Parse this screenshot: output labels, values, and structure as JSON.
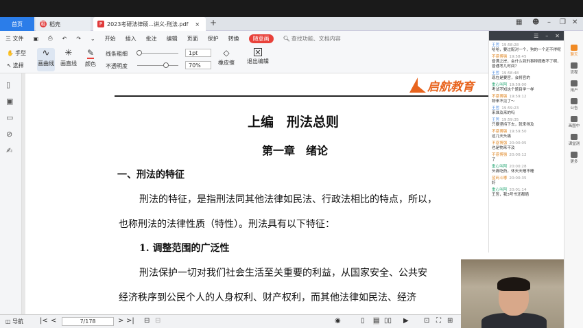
{
  "tabs": {
    "home": "首页",
    "docer": "稻壳",
    "pdf": "2023考研法律硕...讲义-刑法.pdf",
    "add": "+"
  },
  "menu": {
    "file": "三 文件",
    "items": [
      "开始",
      "插入",
      "批注",
      "编辑",
      "页面",
      "保护",
      "转换"
    ],
    "highlight": "随意画",
    "search_placeholder": "查找功能、文档内容"
  },
  "toolbar": {
    "hand": "手型",
    "select": "选择",
    "draw_curve": "画曲线",
    "draw_line": "画直线",
    "color": "颜色",
    "line_weight": "线条粗细",
    "opacity": "不透明度",
    "weight_value": "1pt",
    "opacity_value": "70%",
    "eraser": "橡皮擦",
    "exit": "退出编辑",
    "weight_level": 0.05,
    "opacity_level": 0.7
  },
  "document": {
    "logo": "启航教育",
    "part_title": "上编　刑法总则",
    "chapter_title": "第一章　绪论",
    "section1": "一、刑法的特征",
    "para1_line1": "刑法的特征，是指刑法同其他法律如民法、行政法相比的特点，所以，",
    "para1_line2": "也称刑法的法律性质（特性）。刑法具有以下特征：",
    "sub1": "1. 调整范围的广泛性",
    "para2_line1": "刑法保护一切对我们社会生活至关重要的利益，从国家安全、公共安",
    "para2_line2": "经济秩序到公民个人的人身权利、财产权利，而其他法律如民法、经济"
  },
  "status": {
    "nav": "导航",
    "page": "7/178"
  },
  "chat": {
    "messages": [
      {
        "name": "王哲",
        "time": "19:58:28",
        "text": "哈哈，要过配对一个，狗的一个还不得呢",
        "c": "b"
      },
      {
        "name": "不惑博强",
        "time": "19:58:45",
        "text": "昏满之岸，会什么到刑事辩题看不了啊，普通考几时间？",
        "c": "o"
      },
      {
        "name": "王哲",
        "time": "19:58:48",
        "text": "现在是要官，会将官的",
        "c": "b"
      },
      {
        "name": "重心叫阿",
        "time": "19:59:00",
        "text": "考试不知这个题目学一样",
        "c": "g"
      },
      {
        "name": "不惑博强",
        "time": "19:59:12",
        "text": "物来不见了～",
        "c": "o"
      },
      {
        "name": "王哲",
        "time": "19:59:23",
        "text": "来准及来的吗",
        "c": "b"
      },
      {
        "name": "王哲",
        "time": "19:59:35",
        "text": "只要坚持下去，就来得及",
        "c": "b"
      },
      {
        "name": "不惑博强",
        "time": "19:59:50",
        "text": "这几天头痛",
        "c": "o"
      },
      {
        "name": "不惑博强",
        "time": "20:00:05",
        "text": "也是物来不及",
        "c": "o"
      },
      {
        "name": "不惑博强",
        "time": "20:00:12",
        "text": "了",
        "c": "o"
      },
      {
        "name": "重心叫阿",
        "time": "20:00:28",
        "text": "头痛吃药，休天天睡不睡",
        "c": "g"
      },
      {
        "name": "蓝码斗嘟",
        "time": "20:00:35",
        "text": "好",
        "c": "o"
      },
      {
        "name": "重心叫阿",
        "time": "20:01:14",
        "text": "王哲，我3号书还都晒",
        "c": "g"
      }
    ]
  },
  "right_sidebar": [
    "聊天",
    "流程",
    "用户",
    "公告",
    "画图中",
    "课堂测",
    "更多"
  ],
  "colors": {
    "accent": "#2b7de9",
    "highlight": "#e8413a",
    "logo": "#e8641e"
  }
}
